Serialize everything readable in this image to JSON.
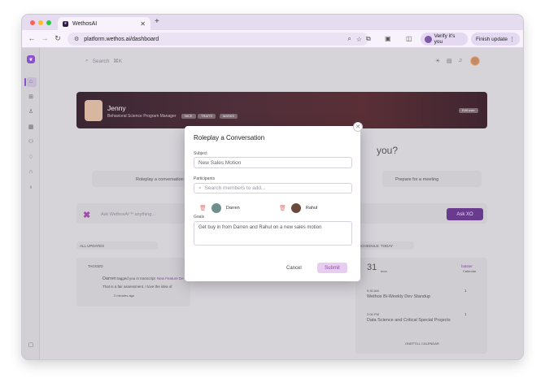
{
  "browser": {
    "tab_title": "WethosAI",
    "url": "platform.wethos.ai/dashboard",
    "verify_label": "Verify it's you",
    "finish_update_label": "Finish update",
    "new_tab": "+",
    "tab_close": "✕"
  },
  "topbar": {
    "search_placeholder": "Search",
    "search_shortcut": "⌘K"
  },
  "banner": {
    "name": "Jenny",
    "role": "Behavioral Science Program Manager",
    "tags": [
      "NICE",
      "TRAITS",
      "MASKS"
    ],
    "edit_label": "Edit user"
  },
  "background": {
    "heading": "you?",
    "roleplay_label": "Roleplay a conversation",
    "meeting_label": "Prepare for a meeting",
    "ask_placeholder": "Ask WethosAI™ anything...",
    "ask_button": "Ask XO",
    "updates_filter": "ALL UPDATES",
    "schedule_filter": "SCHEDULE: TODAY",
    "tagged_label": "TAGGED",
    "feed_name": "Darren",
    "feed_text": "tagged you in transcript",
    "feed_link": "New Feature De",
    "feed_quote": "That is a fair assessment. I love the idea of",
    "feed_time": "2 minutes ago",
    "calendar_day": "31",
    "calendar_month": "mon",
    "calendar_right_top": "hatster",
    "calendar_right_sub": "Calendar",
    "event1_time": "9:30 AM",
    "event1_title": "Wethos Bi-Weekly Dev Standup",
    "event1_count": "1",
    "event2_time": "2:00 PM",
    "event2_title": "Data Science and Critical Special Projects",
    "event2_count": "1",
    "calendar_link": "ONEFTILL CALENDAR"
  },
  "modal": {
    "title": "Roleplay a Conversation",
    "subject_label": "Subject",
    "subject_placeholder": "New Sales Motion",
    "participants_label": "Participants",
    "participants_placeholder": "Search members to add...",
    "participants": [
      {
        "name": "Darren"
      },
      {
        "name": "Rahul"
      }
    ],
    "goals_label": "Goals",
    "goals_value": "Get buy in from Darren and Rahul on a new sales motion",
    "cancel_label": "Cancel",
    "submit_label": "Submit"
  },
  "colors": {
    "accent": "#8a52c9",
    "submit_bg": "#e7cdef",
    "delete_icon": "#e07a7a"
  }
}
